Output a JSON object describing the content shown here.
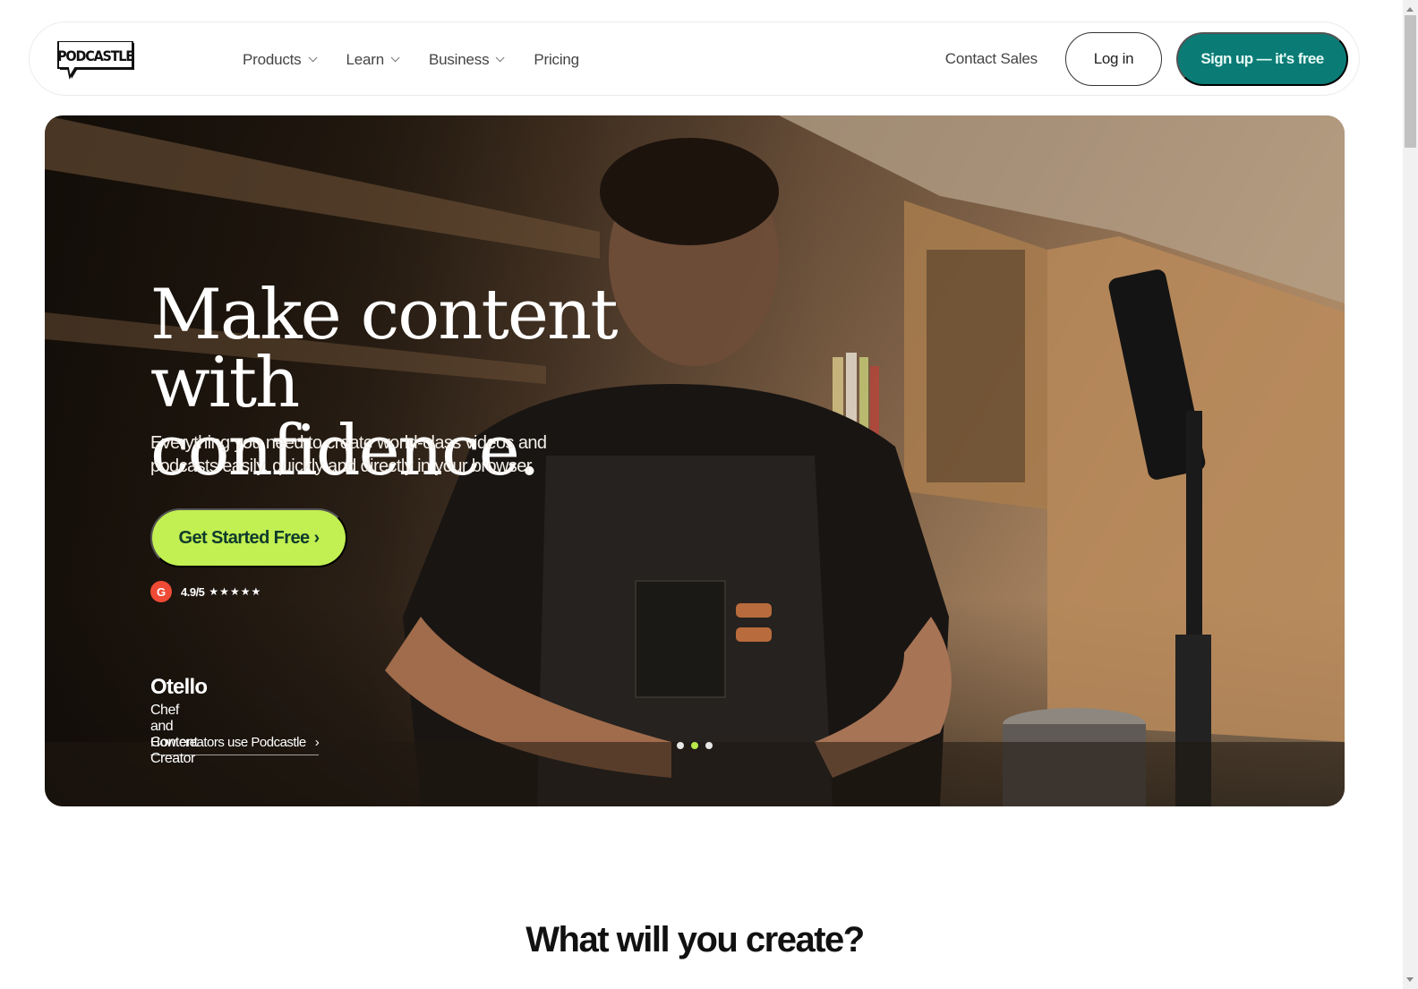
{
  "brand": {
    "name": "PODCASTLE",
    "primary_color": "#0b7b76",
    "accent_color": "#c2ef52"
  },
  "nav": {
    "items": [
      {
        "label": "Products",
        "has_dropdown": true
      },
      {
        "label": "Learn",
        "has_dropdown": true
      },
      {
        "label": "Business",
        "has_dropdown": true
      },
      {
        "label": "Pricing",
        "has_dropdown": false
      }
    ],
    "contact_sales": "Contact Sales",
    "login": "Log in",
    "signup": "Sign up — it's free"
  },
  "hero": {
    "headline_line1": "Make content",
    "headline_line2": "with confidence.",
    "subhead": "Everything you need to create world-class videos and podcasts easily, quickly and directly in your browser.",
    "cta": "Get Started Free ›",
    "rating": {
      "badge": "G",
      "value": "4.9/5",
      "stars": "★★★★★",
      "star_count": 5
    },
    "creator": {
      "name": "Otello",
      "role": "Chef and Content Creator",
      "link": "How creators use Podcastle",
      "link_arrow": "›"
    },
    "carousel": {
      "total": 3,
      "active_index": 1
    }
  },
  "section": {
    "title": "What will you create?"
  }
}
